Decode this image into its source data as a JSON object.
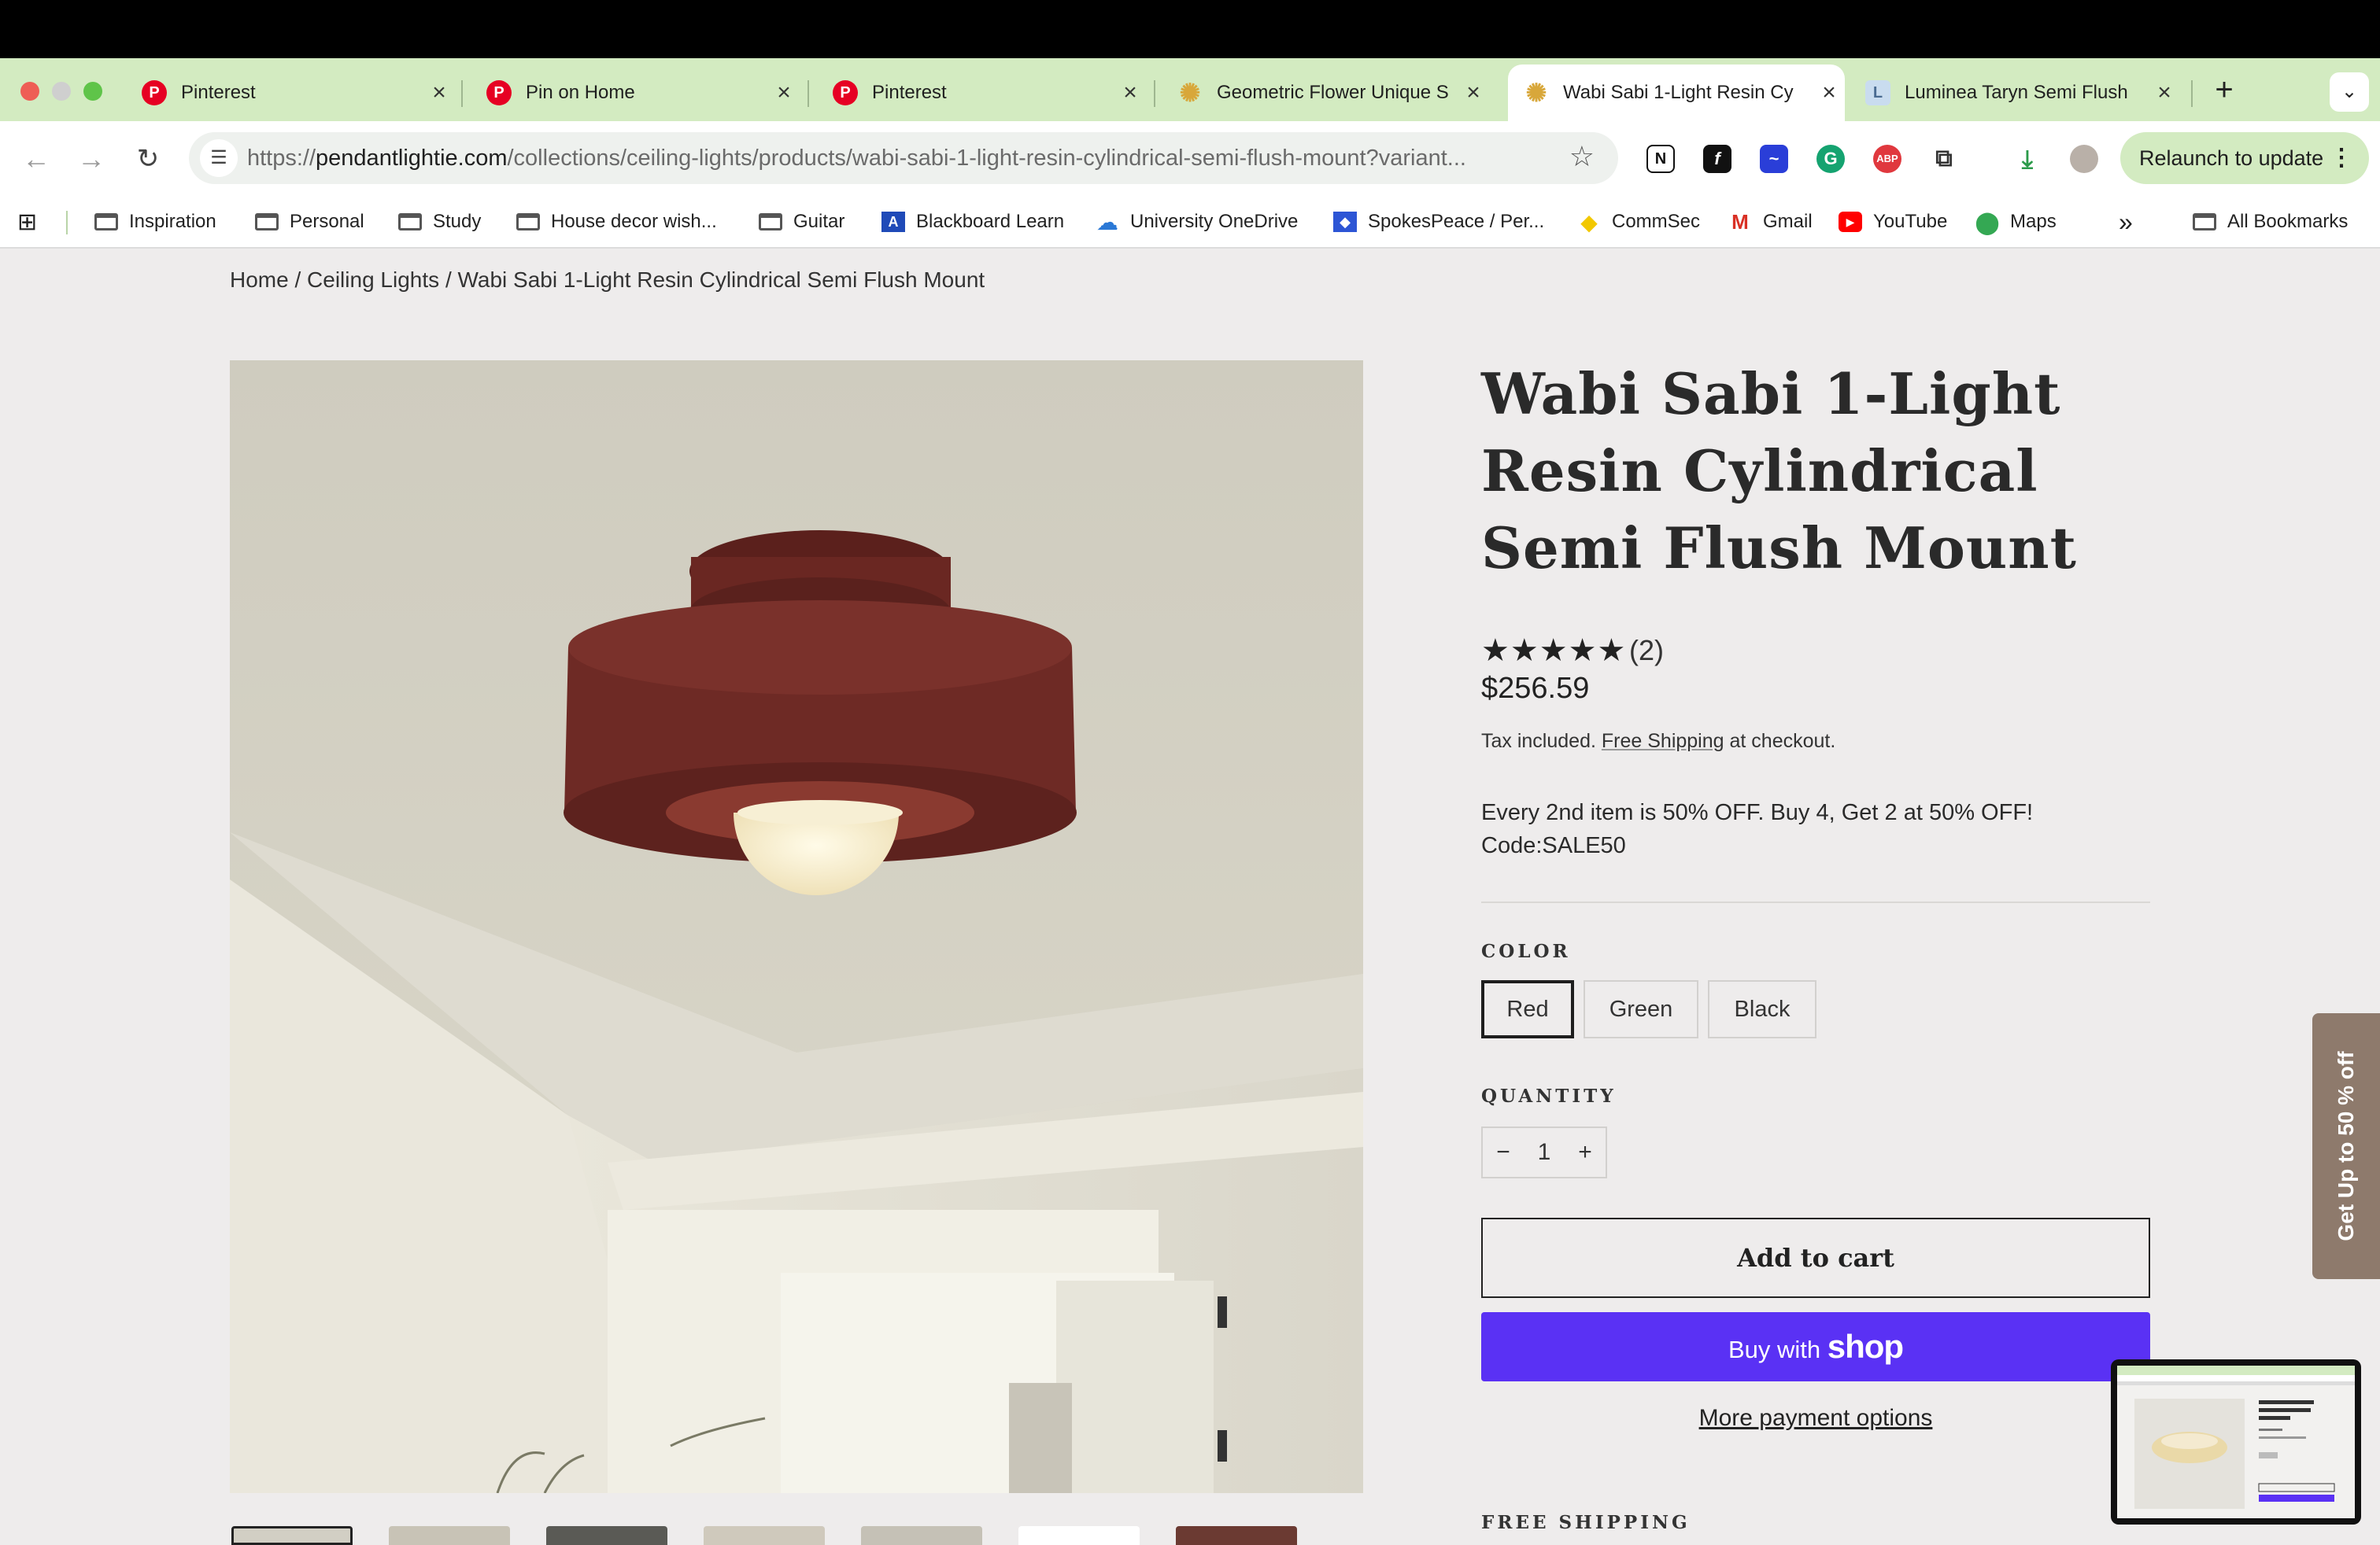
{
  "browser": {
    "tabs": [
      {
        "title": "Pinterest",
        "icon": "pinterest-icon"
      },
      {
        "title": "Pin on Home",
        "icon": "pinterest-icon"
      },
      {
        "title": "Pinterest",
        "icon": "pinterest-icon"
      },
      {
        "title": "Geometric Flower Unique S",
        "icon": "sun-icon"
      },
      {
        "title": "Wabi Sabi 1-Light Resin Cy",
        "icon": "sun-icon",
        "active": true
      },
      {
        "title": "Luminea Taryn Semi Flush",
        "icon": "luminea-icon"
      }
    ],
    "url_prefix": "https://",
    "url_domain": "pendantlightie.com",
    "url_path": "/collections/ceiling-lights/products/wabi-sabi-1-light-resin-cylindrical-semi-flush-mount?variant...",
    "relaunch_label": "Relaunch to update",
    "bookmarks": [
      {
        "label": "Inspiration",
        "icon": "folder-icon"
      },
      {
        "label": "Personal",
        "icon": "folder-icon"
      },
      {
        "label": "Study",
        "icon": "folder-icon"
      },
      {
        "label": "House decor wish...",
        "icon": "folder-icon"
      },
      {
        "label": "Guitar",
        "icon": "folder-icon"
      },
      {
        "label": "Blackboard Learn",
        "icon": "blackboard-icon"
      },
      {
        "label": "University OneDrive",
        "icon": "onedrive-icon"
      },
      {
        "label": "SpokesPeace / Per...",
        "icon": "dropbox-icon"
      },
      {
        "label": "CommSec",
        "icon": "commsec-icon"
      },
      {
        "label": "Gmail",
        "icon": "gmail-icon"
      },
      {
        "label": "YouTube",
        "icon": "youtube-icon"
      },
      {
        "label": "Maps",
        "icon": "maps-icon"
      }
    ],
    "overflow_label": "»",
    "all_bookmarks_label": "All Bookmarks"
  },
  "page": {
    "breadcrumb": {
      "home": "Home",
      "sep": "/",
      "category": "Ceiling Lights",
      "current": "Wabi Sabi 1-Light Resin Cylindrical Semi Flush Mount"
    },
    "product": {
      "title": "Wabi Sabi 1-Light Resin Cylindrical Semi Flush Mount",
      "rating_stars": "★★★★★",
      "review_count": "(2)",
      "price": "$256.59",
      "tax_prefix": "Tax included.",
      "tax_link": "Free Shipping",
      "tax_suffix": "at checkout.",
      "promo_line1": "Every 2nd item is 50% OFF. Buy 4, Get 2 at 50% OFF!",
      "promo_line2": "Code:SALE50",
      "color_label": "COLOR",
      "colors": [
        "Red",
        "Green",
        "Black"
      ],
      "selected_color": "Red",
      "quantity_label": "QUANTITY",
      "quantity": "1",
      "qty_minus": "−",
      "qty_plus": "+",
      "add_to_cart": "Add to cart",
      "buy_with": "Buy with",
      "shop_word": "shop",
      "more_payment": "More payment options",
      "free_shipping_label": "FREE SHIPPING"
    },
    "side_promo": "Get Up to 50 % off",
    "colors": {
      "lamp": "#6e2a25",
      "buy_button": "#5a31f4",
      "side_tab": "#8e7a6c",
      "tab_strip": "#d3ebc1"
    }
  }
}
